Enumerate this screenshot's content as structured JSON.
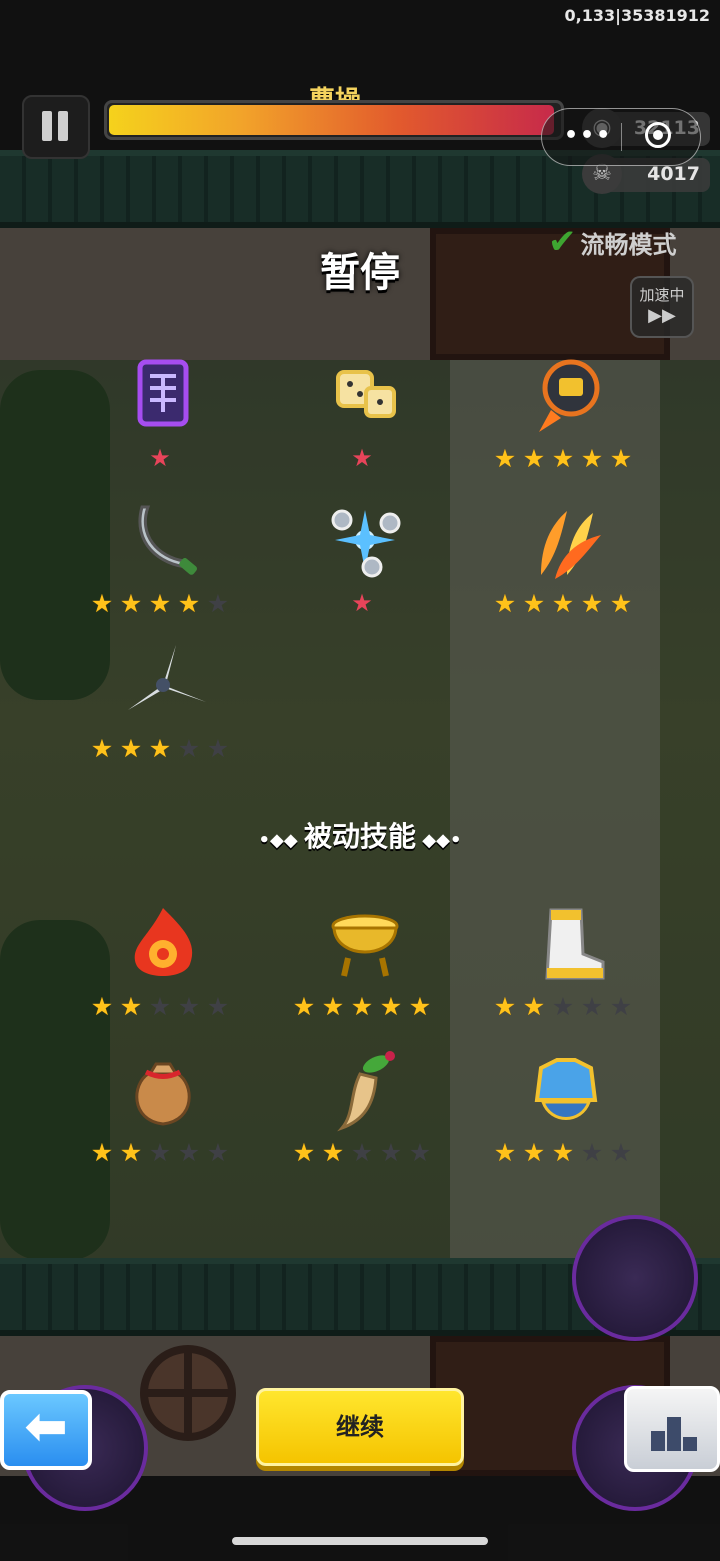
{
  "status": {
    "text": "0,133|35381912"
  },
  "hud": {
    "boss_name": "曹操",
    "boss_hp_fraction": 0.98,
    "coins": "32113",
    "kills": "4017"
  },
  "pause_panel": {
    "title": "暂停",
    "smooth_mode_label": "流畅模式",
    "speed_label": "加速中",
    "passive_title": "被动技能",
    "active_skills": [
      {
        "icon": "purple-talisman-icon",
        "stars": 0,
        "max_stars": 0,
        "gem": true,
        "color": "#a64df0"
      },
      {
        "icon": "golden-dice-icon",
        "stars": 0,
        "max_stars": 0,
        "gem": true,
        "color": "#e8c24a"
      },
      {
        "icon": "rocket-drone-icon",
        "stars": 5,
        "max_stars": 5,
        "gem": false,
        "color": "#e8741f"
      },
      {
        "icon": "curved-sword-icon",
        "stars": 4,
        "max_stars": 5,
        "gem": false,
        "color": "#b9c3c8"
      },
      {
        "icon": "ice-orbs-icon",
        "stars": 0,
        "max_stars": 0,
        "gem": true,
        "color": "#5bc0ff"
      },
      {
        "icon": "flame-feathers-icon",
        "stars": 5,
        "max_stars": 5,
        "gem": false,
        "color": "#ff9d2a"
      },
      {
        "icon": "spinning-blades-icon",
        "stars": 3,
        "max_stars": 5,
        "gem": false,
        "color": "#d8dde0"
      }
    ],
    "passive_skills": [
      {
        "icon": "fire-spirit-icon",
        "stars": 2,
        "max_stars": 5,
        "color": "#e8361f"
      },
      {
        "icon": "golden-cauldron-icon",
        "stars": 5,
        "max_stars": 5,
        "color": "#e8b82a"
      },
      {
        "icon": "boot-icon",
        "stars": 2,
        "max_stars": 5,
        "color": "#f0f0f0"
      },
      {
        "icon": "coin-bag-icon",
        "stars": 2,
        "max_stars": 5,
        "color": "#c98a4a"
      },
      {
        "icon": "ginseng-icon",
        "stars": 2,
        "max_stars": 5,
        "color": "#e7c48a"
      },
      {
        "icon": "armor-icon",
        "stars": 3,
        "max_stars": 5,
        "color": "#4aa3e8"
      }
    ]
  },
  "buttons": {
    "continue_label": "继续"
  }
}
